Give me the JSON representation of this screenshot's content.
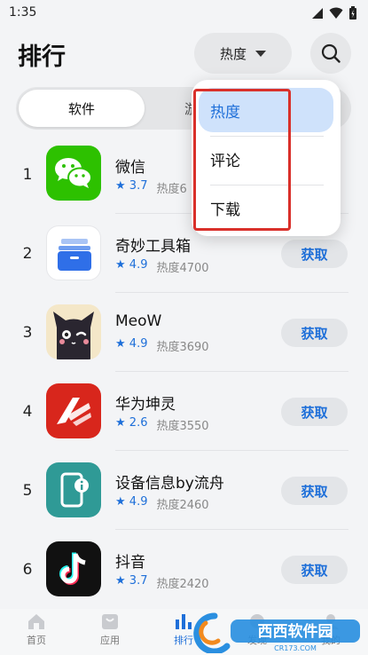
{
  "status_bar": {
    "time": "1:35"
  },
  "header": {
    "title": "排行",
    "sort_label": "热度"
  },
  "tabs": [
    {
      "label": "软件"
    },
    {
      "label": "游戏"
    }
  ],
  "dropdown": {
    "items": [
      {
        "label": "热度"
      },
      {
        "label": "评论"
      },
      {
        "label": "下载"
      }
    ]
  },
  "apps": [
    {
      "rank": "1",
      "name": "微信",
      "rating": "3.7",
      "heat": "热度6",
      "action": "获取",
      "icon": "wechat-icon"
    },
    {
      "rank": "2",
      "name": "奇妙工具箱",
      "rating": "4.9",
      "heat": "热度4700",
      "action": "获取",
      "icon": "toolbox-icon"
    },
    {
      "rank": "3",
      "name": "MeoW",
      "rating": "4.9",
      "heat": "热度3690",
      "action": "获取",
      "icon": "black-cat-icon"
    },
    {
      "rank": "4",
      "name": "华为坤灵",
      "rating": "2.6",
      "heat": "热度3550",
      "action": "获取",
      "icon": "huawei-kunling-icon"
    },
    {
      "rank": "5",
      "name": "设备信息by流舟",
      "rating": "4.9",
      "heat": "热度2460",
      "action": "获取",
      "icon": "device-info-icon"
    },
    {
      "rank": "6",
      "name": "抖音",
      "rating": "3.7",
      "heat": "热度2420",
      "action": "获取",
      "icon": "douyin-icon"
    }
  ],
  "bottom_nav": [
    {
      "label": "首页",
      "icon": "home-icon"
    },
    {
      "label": "应用",
      "icon": "bag-icon"
    },
    {
      "label": "排行",
      "icon": "bar-chart-icon"
    },
    {
      "label": "发现",
      "icon": "discover-icon"
    },
    {
      "label": "我的",
      "icon": "profile-icon"
    }
  ],
  "watermark": {
    "text": "西西软件园",
    "url_text": "CR173.COM"
  },
  "colors": {
    "accent": "#1e6fd9",
    "highlight_border": "#d9302a",
    "selected_bg": "#cfe2fb"
  }
}
